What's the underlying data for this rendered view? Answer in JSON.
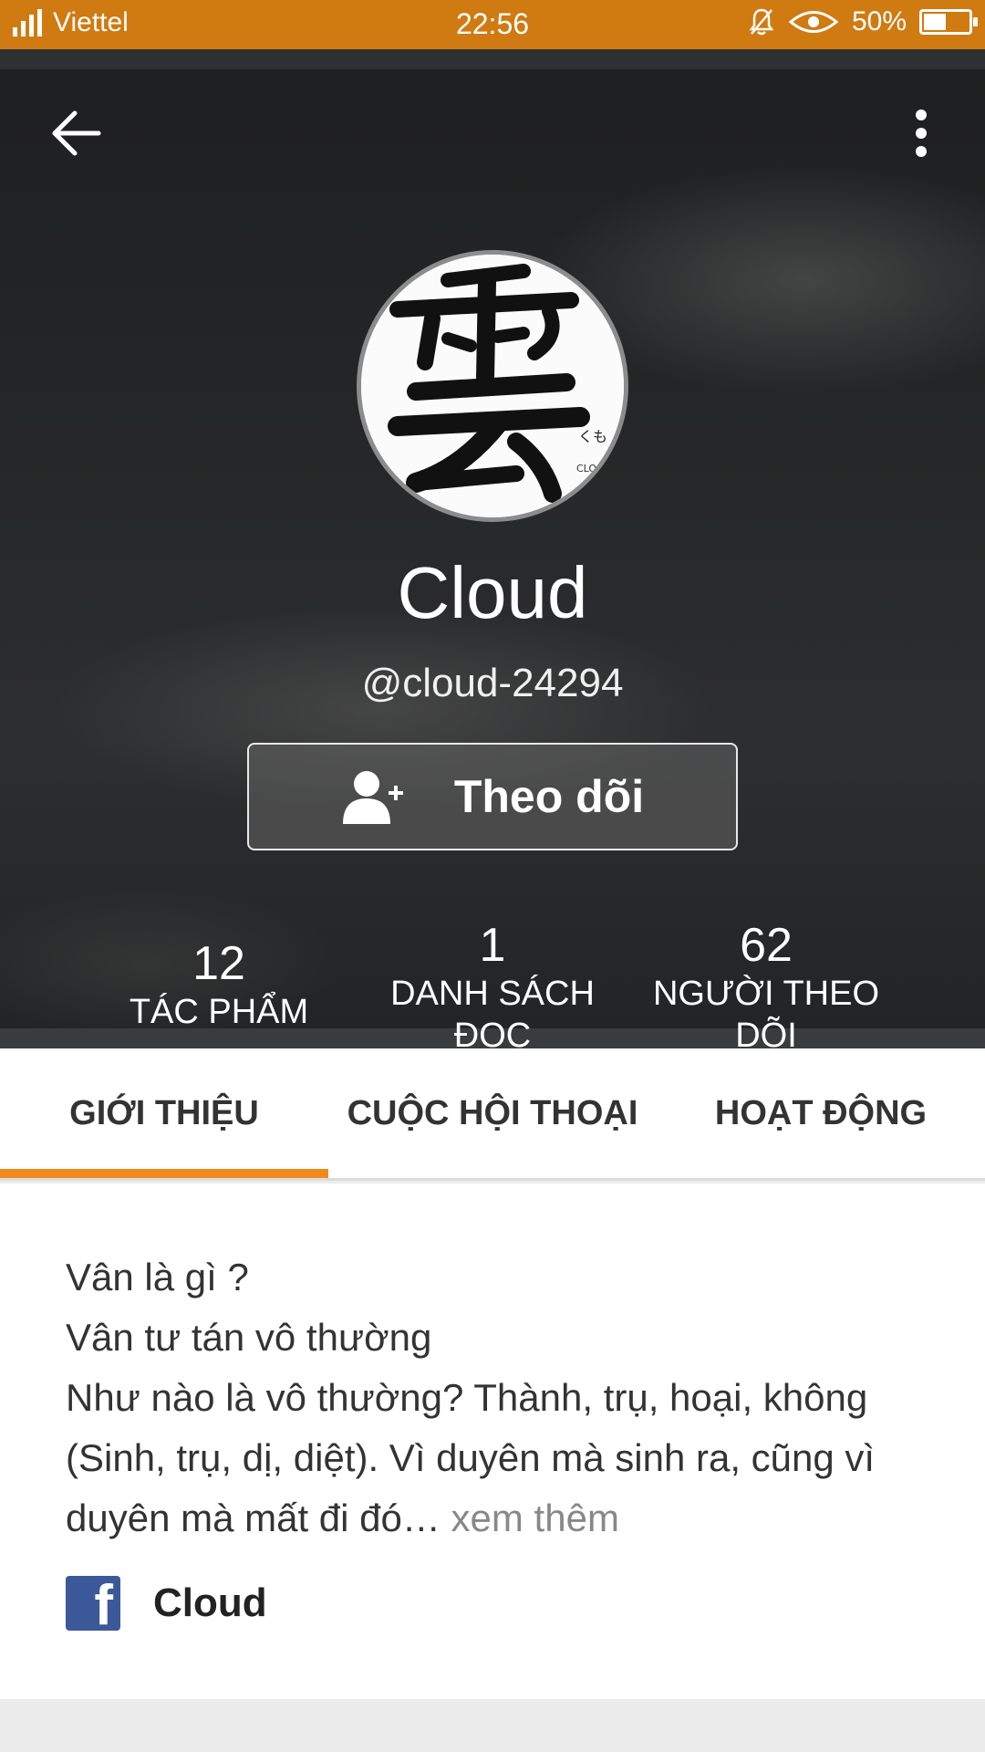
{
  "status_bar": {
    "carrier": "Viettel",
    "time": "22:56",
    "battery": "50%",
    "battery_level": 0.5
  },
  "header": {
    "name": "Cloud",
    "handle": "@cloud-24294",
    "follow_label": "Theo dõi",
    "icons": {
      "back": "back-arrow-icon",
      "more": "more-vert-icon",
      "follow": "add-user-icon"
    }
  },
  "stats": [
    {
      "value": "12",
      "label_lines": [
        "TÁC PHẨM"
      ]
    },
    {
      "value": "1",
      "label_lines": [
        "DANH SÁCH",
        "ĐỌC"
      ]
    },
    {
      "value": "62",
      "label_lines": [
        "NGƯỜI THEO",
        "DÕI"
      ]
    }
  ],
  "tabs": [
    {
      "label": "GIỚI THIỆU",
      "active": true
    },
    {
      "label": "CUỘC HỘI THOẠI",
      "active": false
    },
    {
      "label": "HOẠT ĐỘNG",
      "active": false
    }
  ],
  "about": {
    "lines": [
      "Vân là gì ?",
      "Vân tư tán vô thường",
      "Như nào là vô thường? Thành, trụ, hoại, không (Sinh, trụ, dị, diệt). Vì duyên mà sinh ra, cũng vì duyên mà mất đi đó"
    ],
    "ellipsis": "…",
    "see_more": "xem thêm",
    "facebook_name": "Cloud"
  },
  "colors": {
    "status_bar": "#d07a12",
    "accent": "#f08a1c",
    "facebook": "#3b5998"
  }
}
